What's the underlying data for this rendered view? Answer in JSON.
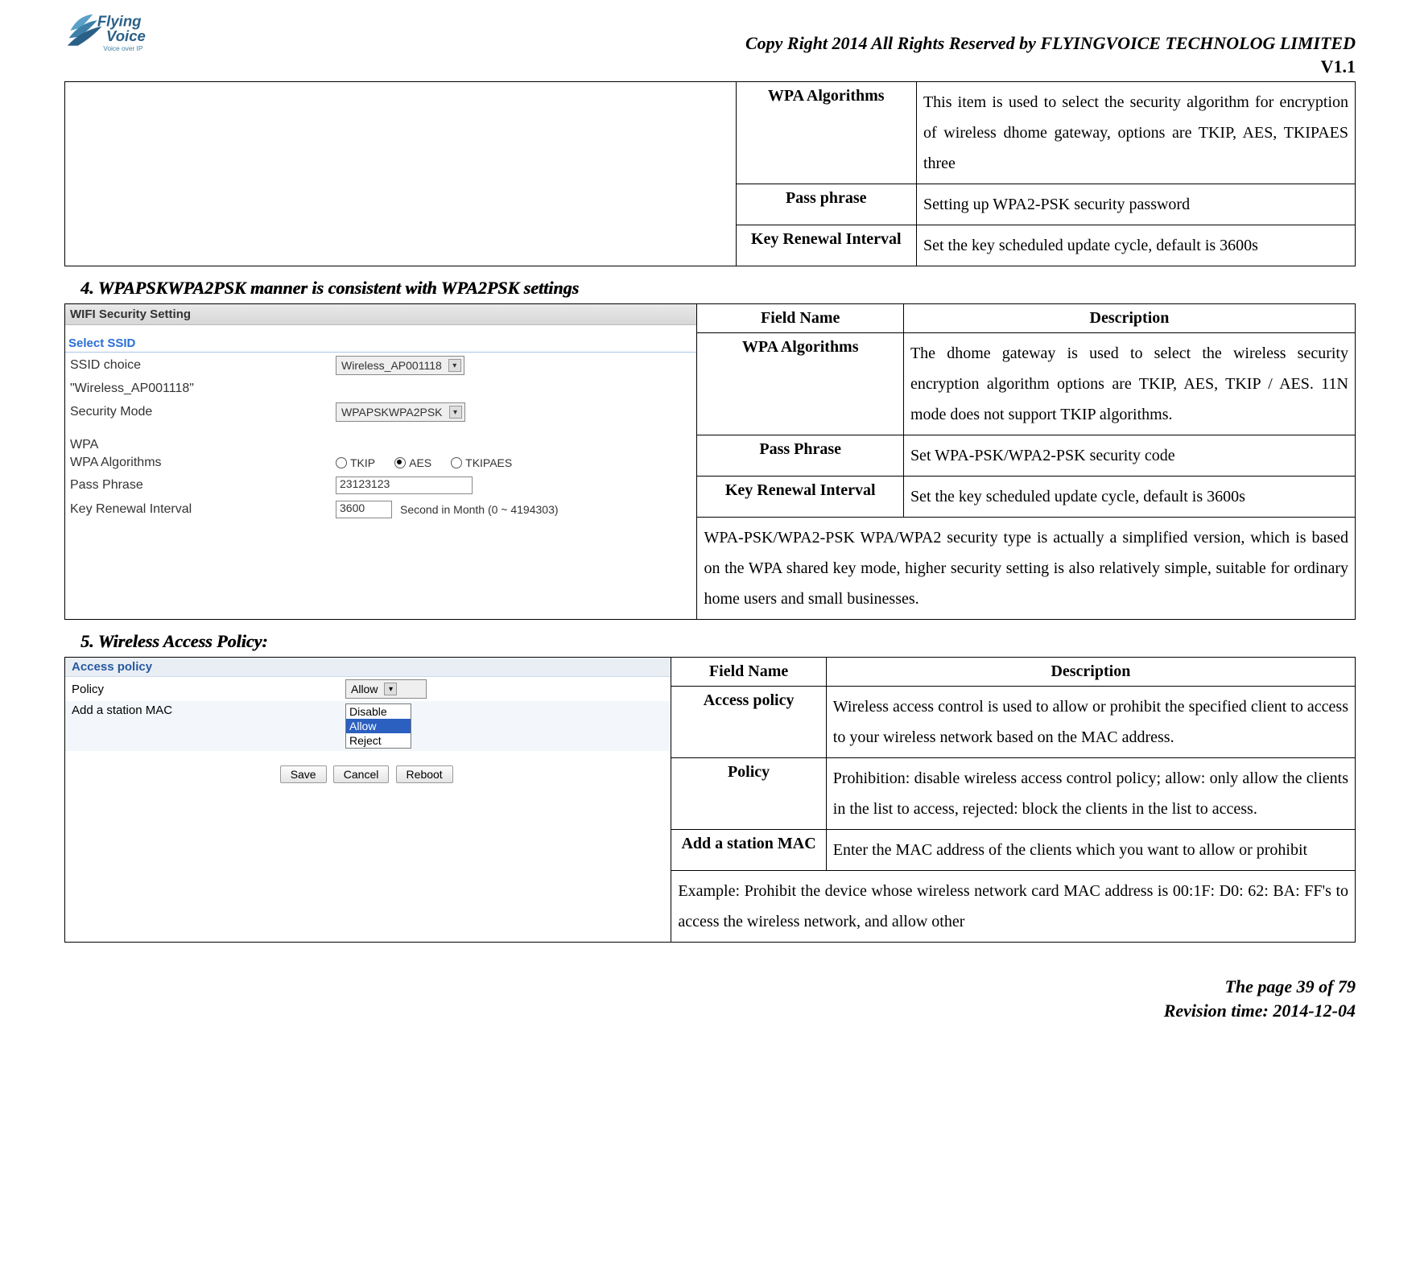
{
  "header": {
    "logo_brand_1": "Flying",
    "logo_brand_2": "Voice",
    "logo_tagline": "Voice over IP",
    "copyright": "Copy Right 2014 All Rights Reserved by FLYINGVOICE TECHNOLOG LIMITED",
    "version": "V1.1"
  },
  "table1": {
    "rows": [
      {
        "field": "WPA Algorithms",
        "desc": "This item is used to select the security algorithm for encryption of wireless dhome gateway, options are TKIP, AES, TKIPAES three"
      },
      {
        "field": "Pass phrase",
        "desc": "Setting up WPA2-PSK security password"
      },
      {
        "field": "Key Renewal Interval",
        "desc": "Set the key scheduled update cycle, default is 3600s"
      }
    ]
  },
  "section4": {
    "title": "4.  WPAPSKWPA2PSK manner is consistent with WPA2PSK settings",
    "screenshot": {
      "title": "WIFI Security Setting",
      "legend": "Select SSID",
      "ssid_choice_label": "SSID choice",
      "ssid_choice_value": "Wireless_AP001118",
      "ssid_quoted": "\"Wireless_AP001118\"",
      "security_mode_label": "Security Mode",
      "security_mode_value": "WPAPSKWPA2PSK",
      "wpa_section": "WPA",
      "wpa_alg_label": "WPA Algorithms",
      "alg_tkip": "TKIP",
      "alg_aes": "AES",
      "alg_tkipaes": "TKIPAES",
      "pass_phrase_label": "Pass Phrase",
      "pass_phrase_value": "23123123",
      "key_renewal_label": "Key Renewal Interval",
      "key_renewal_value": "3600",
      "key_renewal_suffix": "Second in Month   (0 ~ 4194303)"
    },
    "table": {
      "head_field": "Field Name",
      "head_desc": "Description",
      "rows": [
        {
          "field": "WPA Algorithms",
          "desc": "The dhome gateway is used to select the wireless security encryption algorithm options are TKIP, AES, TKIP / AES. 11N mode does not support TKIP algorithms."
        },
        {
          "field": "Pass Phrase",
          "desc": "Set WPA-PSK/WPA2-PSK security code"
        },
        {
          "field": "Key Renewal Interval",
          "desc": "Set the key scheduled update cycle, default is 3600s"
        }
      ],
      "note": "WPA-PSK/WPA2-PSK WPA/WPA2 security type is actually a simplified version, which is based on the WPA shared key mode, higher security setting is also relatively simple, suitable for ordinary home users and small businesses."
    }
  },
  "section5": {
    "title": "5.  Wireless Access Policy:",
    "screenshot": {
      "header": "Access policy",
      "policy_label": "Policy",
      "policy_value": "Allow",
      "add_mac_label": "Add a station MAC",
      "options": {
        "disable": "Disable",
        "allow": "Allow",
        "reject": "Reject"
      },
      "btn_save": "Save",
      "btn_cancel": "Cancel",
      "btn_reboot": "Reboot"
    },
    "table": {
      "head_field": "Field Name",
      "head_desc": "Description",
      "rows": [
        {
          "field": "Access policy",
          "desc": "Wireless access control is used to allow or prohibit the specified client to access to your wireless network based on the MAC address."
        },
        {
          "field": "Policy",
          "desc": "Prohibition: disable wireless access control policy; allow: only allow the clients in the list to access, rejected: block the clients in the list to access."
        },
        {
          "field": "Add a station MAC",
          "desc": "Enter the MAC address of the clients which you want to allow or prohibit"
        }
      ],
      "example": "Example: Prohibit the device whose wireless network card MAC address is 00:1F: D0: 62: BA: FF's to access the wireless network, and allow other"
    }
  },
  "footer": {
    "page": "The page 39 of 79",
    "revision": "Revision time: 2014-12-04"
  }
}
